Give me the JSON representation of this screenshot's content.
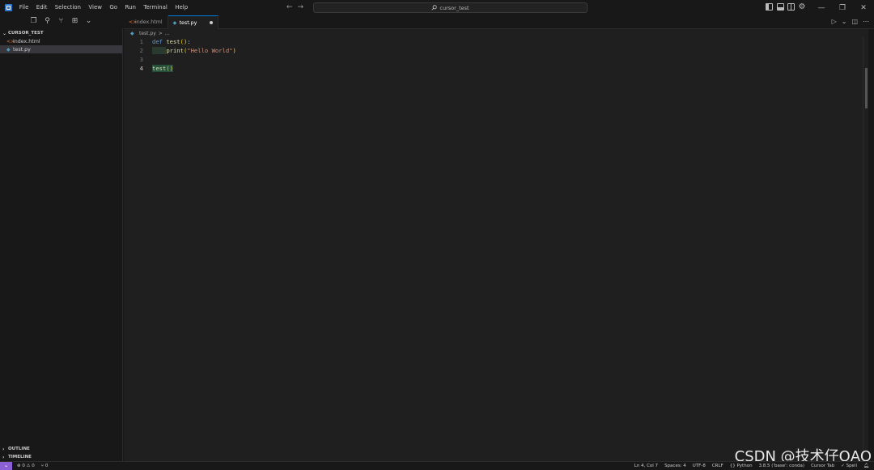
{
  "menu": [
    "File",
    "Edit",
    "Selection",
    "View",
    "Go",
    "Run",
    "Terminal",
    "Help"
  ],
  "search": {
    "label": "cursor_test"
  },
  "nav": {
    "back": "←",
    "forward": "→"
  },
  "window": {
    "minimize": "—",
    "restore": "❐",
    "close": "✕"
  },
  "sidebar": {
    "project": "CURSOR_TEST",
    "files": [
      {
        "name": "index.html",
        "icon": "html-icon"
      },
      {
        "name": "test.py",
        "icon": "python-icon",
        "selected": true
      }
    ],
    "outline": "OUTLINE",
    "timeline": "TIMELINE"
  },
  "tabs": [
    {
      "label": "index.html",
      "icon": "html-icon"
    },
    {
      "label": "test.py",
      "icon": "python-icon",
      "active": true,
      "modified": true
    }
  ],
  "breadcrumb": {
    "file": "test.py",
    "sep": ">",
    "more": "..."
  },
  "editor": {
    "line_numbers": [
      "1",
      "2",
      "3",
      "4"
    ],
    "line1": {
      "kw": "def",
      "fn": "test",
      "open": "(",
      "close": ")",
      "colon": ":"
    },
    "line2": {
      "fn": "print",
      "open": "(",
      "str": "\"Hello World\"",
      "close": ")"
    },
    "line4": {
      "fn": "test",
      "parens": "()"
    }
  },
  "status": {
    "errors": "0",
    "warnings": "0",
    "ports": "0",
    "position": "Ln 4, Col 7",
    "spaces": "Spaces: 4",
    "encoding": "UTF-8",
    "eol": "CRLF",
    "language": "Python",
    "interpreter": "3.8.5 ('base': conda)",
    "cursor_tab": "Cursor Tab",
    "spell": "Spell"
  },
  "watermark": "CSDN @技术仔QAQ",
  "colors": {
    "accent": "#0078d4",
    "remote": "#8b60d6",
    "html_icon": "#e37933",
    "python_icon": "#519aba"
  }
}
